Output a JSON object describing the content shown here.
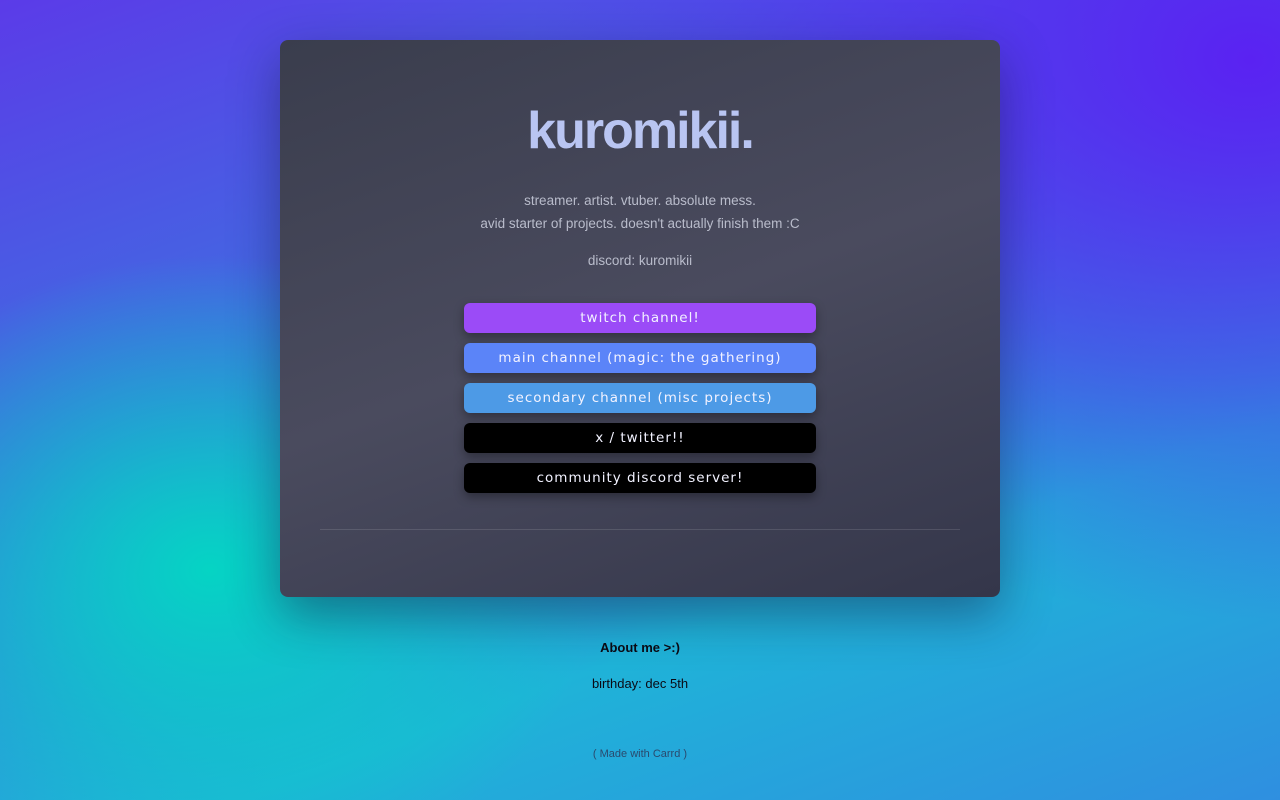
{
  "profile": {
    "title": "kuromikii.",
    "bio_line1": "streamer. artist. vtuber. absolute mess.",
    "bio_line2": "avid starter of projects. doesn't actually finish them :C",
    "discord": "discord: kuromikii"
  },
  "links": [
    {
      "label": "twitch channel!",
      "color": "#9b4bf7"
    },
    {
      "label": "main channel (magic: the gathering)",
      "color": "#5b84f8"
    },
    {
      "label": "secondary channel (misc projects)",
      "color": "#4d9ae6"
    },
    {
      "label": "x / twitter!!",
      "color": "#000000"
    },
    {
      "label": "community discord server!",
      "color": "#000000"
    }
  ],
  "about": {
    "heading": "About me >:)",
    "birthday": "birthday: dec 5th"
  },
  "footer": {
    "open": "( ",
    "link": "Made with Carrd",
    "close": " )"
  }
}
